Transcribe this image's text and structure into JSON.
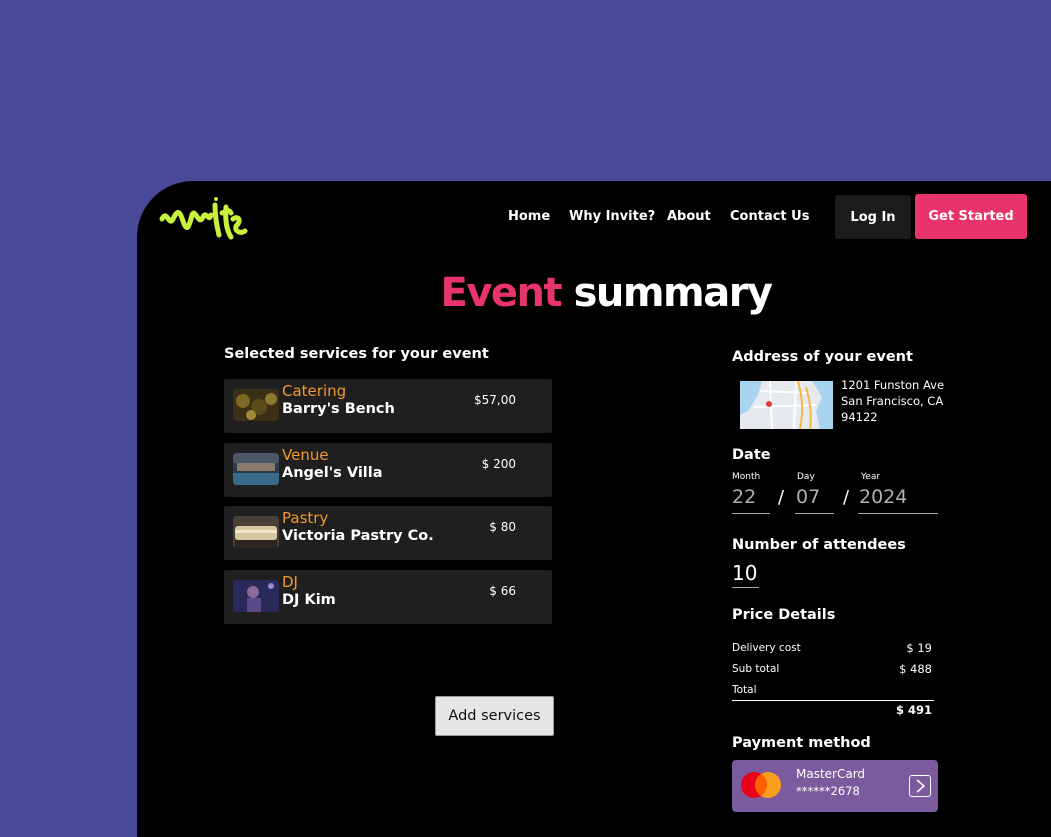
{
  "header": {
    "nav": [
      "Home",
      "Why Invite?",
      "About",
      "Contact Us"
    ],
    "login_label": "Log In",
    "cta_label": "Get Started"
  },
  "title": {
    "accent": "Event",
    "rest": "summary"
  },
  "services": {
    "heading": "Selected services for your event",
    "items": [
      {
        "category": "Catering",
        "name": "Barry's Bench",
        "price": "$57,00"
      },
      {
        "category": "Venue",
        "name": "Angel's Villa",
        "price": "$ 200"
      },
      {
        "category": "Pastry",
        "name": "Victoria Pastry Co.",
        "price": "$ 80"
      },
      {
        "category": "DJ",
        "name": "DJ Kim",
        "price": "$ 66"
      }
    ],
    "add_label": "Add services"
  },
  "address": {
    "heading": "Address of your event",
    "line1": "1201 Funston Ave",
    "line2": "San Francisco, CA",
    "line3": "94122"
  },
  "date": {
    "heading": "Date",
    "month_label": "Month",
    "day_label": "Day",
    "year_label": "Year",
    "month": "22",
    "day": "07",
    "year": "2024",
    "separator": "/"
  },
  "attendees": {
    "heading": "Number of attendees",
    "value": "10"
  },
  "price": {
    "heading": "Price Details",
    "delivery_label": "Delivery cost",
    "delivery_value": "$ 19",
    "subtotal_label": "Sub total",
    "subtotal_value": "$ 488",
    "total_label": "Total",
    "total_value": "$ 491"
  },
  "payment": {
    "heading": "Payment method",
    "card_name": "MasterCard",
    "card_number": "******2678",
    "next_icon": "chevron-right-icon"
  },
  "colors": {
    "background": "#4a4899",
    "accent": "#e8336b",
    "category": "#f39a2b",
    "logo": "#c8f23a",
    "payment_card": "#7b5a9e"
  }
}
